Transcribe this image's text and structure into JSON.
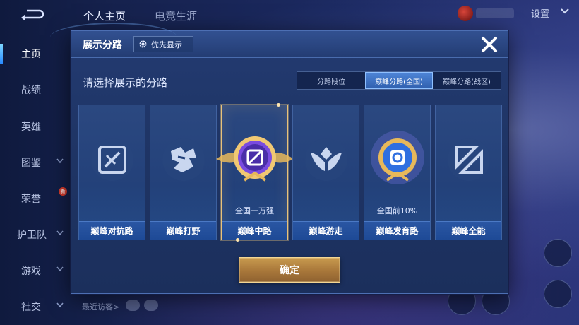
{
  "header": {
    "tabs": [
      {
        "label": "个人主页"
      },
      {
        "label": "电竞生涯"
      }
    ],
    "settings_label": "设置"
  },
  "sidebar": {
    "items": [
      {
        "label": "主页",
        "active": true
      },
      {
        "label": "战绩"
      },
      {
        "label": "英雄"
      },
      {
        "label": "图鉴"
      },
      {
        "label": "荣誉",
        "badge": "新"
      },
      {
        "label": "护卫队"
      },
      {
        "label": "游戏"
      },
      {
        "label": "社交"
      }
    ]
  },
  "footer": {
    "recent_visitors": "最近访客>"
  },
  "dialog": {
    "title": "展示分路",
    "priority_label": "优先显示",
    "prompt": "请选择展示的分路",
    "tabs": [
      {
        "label": "分路段位"
      },
      {
        "label": "巅峰分路(全国)",
        "active": true
      },
      {
        "label": "巅峰分路(战区)"
      }
    ],
    "cards": [
      {
        "name": "巅峰对抗路",
        "icon": "clash-lane-icon",
        "subtitle": ""
      },
      {
        "name": "巅峰打野",
        "icon": "jungle-icon",
        "subtitle": ""
      },
      {
        "name": "巅峰中路",
        "icon": "mid-lane-gold-badge-icon",
        "subtitle": "全国一万强",
        "selected": true
      },
      {
        "name": "巅峰游走",
        "icon": "roam-icon",
        "subtitle": ""
      },
      {
        "name": "巅峰发育路",
        "icon": "farm-lane-gold-badge-icon",
        "subtitle": "全国前10%"
      },
      {
        "name": "巅峰全能",
        "icon": "all-round-icon",
        "subtitle": ""
      }
    ],
    "confirm_label": "确定"
  },
  "colors": {
    "dialog_bg": "#1f3566",
    "tab_active": "#3f73c6",
    "selected_border": "#e8c27a",
    "confirm_gold": "#b0803f"
  }
}
